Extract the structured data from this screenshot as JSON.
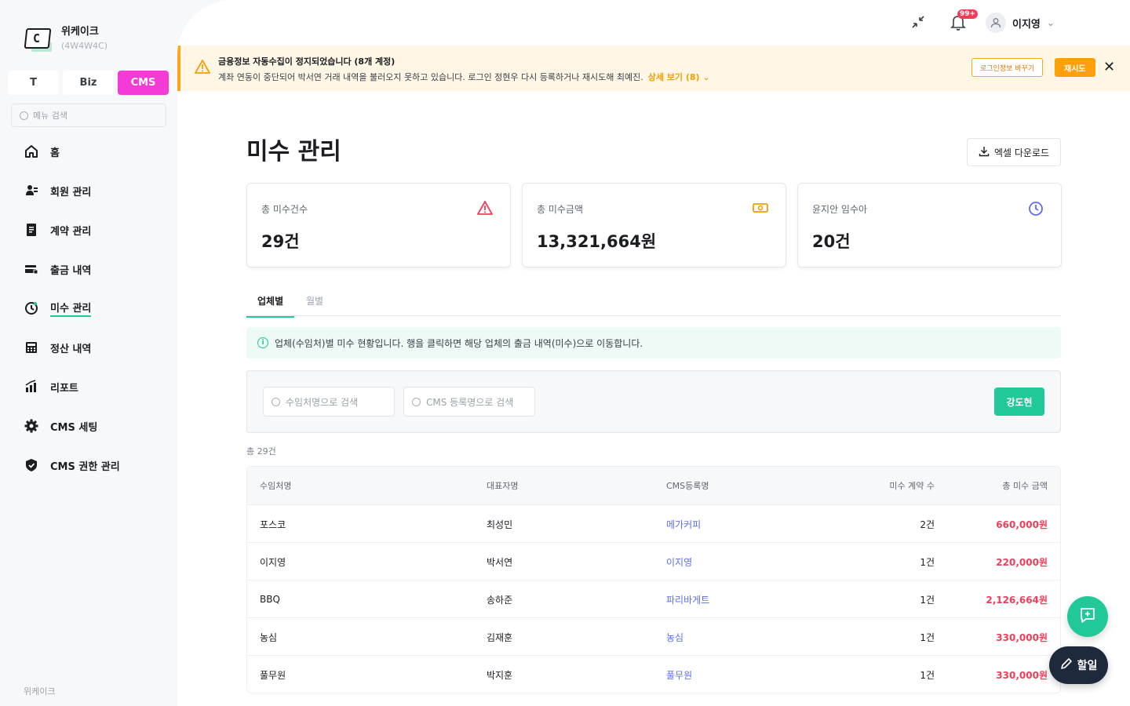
{
  "brand": {
    "name": "위케이크",
    "code": "(4W4W4C)"
  },
  "mode_tabs": [
    "T",
    "Biz",
    "CMS"
  ],
  "menu_search": {
    "placeholder": "메뉴 검색"
  },
  "nav": [
    {
      "label": "홈",
      "icon": "home-icon"
    },
    {
      "label": "회원 관리",
      "icon": "member-icon"
    },
    {
      "label": "계약 관리",
      "icon": "contract-icon"
    },
    {
      "label": "출금 내역",
      "icon": "card-icon"
    },
    {
      "label": "미수 관리",
      "icon": "clock-icon"
    },
    {
      "label": "정산 내역",
      "icon": "calculator-icon"
    },
    {
      "label": "리포트",
      "icon": "chart-icon"
    },
    {
      "label": "CMS 세팅",
      "icon": "gear-icon"
    },
    {
      "label": "CMS 권한 관리",
      "icon": "shield-icon"
    }
  ],
  "sidebar_footer": "위케이크",
  "topbar": {
    "badge": "99+",
    "user_name": "이지영"
  },
  "alert": {
    "title": "금융정보 자동수집이 정지되었습니다 (8개 계정)",
    "desc": "계좌 연동이 중단되어 박서연 거래 내역을 불러오지 못하고 있습니다. 로그인 정현우 다시 등록하거나 재시도해 최예진.",
    "more": "상세 보기 (8)",
    "btn_change": "로그인정보 바꾸기",
    "btn_retry": "재시도"
  },
  "page_title": "미수 관리",
  "excel_label": "엑셀 다운로드",
  "cards": [
    {
      "label": "총 미수건수",
      "value": "29건"
    },
    {
      "label": "총 미수금액",
      "value": "13,321,664원"
    },
    {
      "label": "윤지안 임수아",
      "value": "20건"
    }
  ],
  "tabs": [
    "업체별",
    "월별"
  ],
  "info_text": "업체(수임처)별 미수 현황입니다. 행을 클릭하면 해당 업체의 출금 내역(미수)으로 이동합니다.",
  "filters": {
    "client_placeholder": "수임처명으로 검색",
    "cms_placeholder": "CMS 등록명으로 검색",
    "search_label": "강도현"
  },
  "total_label": "총 29건",
  "table": {
    "headers": [
      "수임처명",
      "대표자명",
      "CMS등록명",
      "미수 계약 수",
      "총 미수 금액"
    ],
    "rows": [
      [
        "포스코",
        "최성민",
        "메가커피",
        "2건",
        "660,000원"
      ],
      [
        "이지영",
        "박서연",
        "이지영",
        "1건",
        "220,000원"
      ],
      [
        "BBQ",
        "송하준",
        "파리바게트",
        "1건",
        "2,126,664원"
      ],
      [
        "농심",
        "김재훈",
        "농심",
        "1건",
        "330,000원"
      ],
      [
        "풀무원",
        "박지훈",
        "풀무원",
        "1건",
        "330,000원"
      ]
    ]
  },
  "fab_todo": "할일",
  "colors": {
    "accent": "#20c997",
    "cms_pink": "#f43ad7",
    "warning": "#ffa41b",
    "danger": "#f03e5a",
    "link": "#5c6fe6"
  }
}
